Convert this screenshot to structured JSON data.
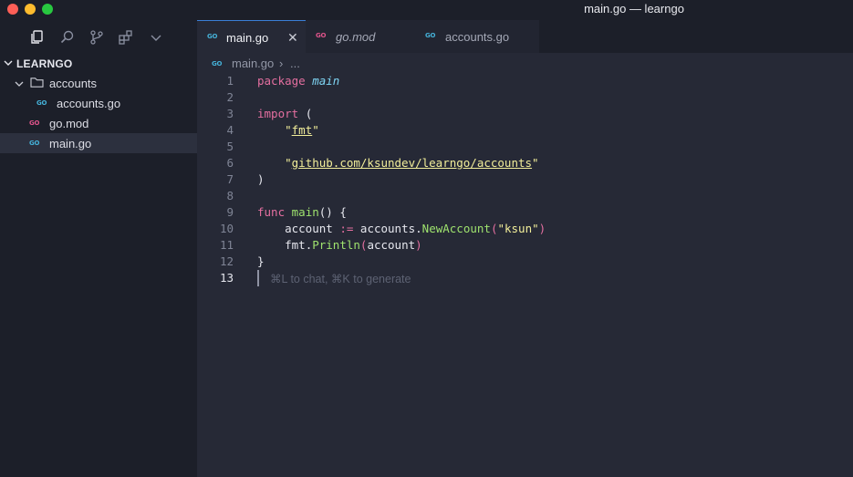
{
  "window": {
    "title": "main.go — learngo"
  },
  "activity_bar": {
    "icons": [
      "files-icon",
      "search-icon",
      "source-control-icon",
      "extensions-icon",
      "chevron-down-icon"
    ]
  },
  "explorer": {
    "root_label": "LEARNGO",
    "items": [
      {
        "label": "accounts",
        "type": "folder",
        "icon": "folder-icon"
      },
      {
        "label": "accounts.go",
        "type": "file",
        "icon": "go-file-icon",
        "badge": "GO"
      },
      {
        "label": "go.mod",
        "type": "file",
        "icon": "go-mod-icon",
        "badge": "GO"
      },
      {
        "label": "main.go",
        "type": "file",
        "icon": "go-file-icon",
        "badge": "GO",
        "selected": true
      }
    ]
  },
  "tabs": [
    {
      "label": "main.go",
      "badge": "GO",
      "active": true,
      "close": "✕"
    },
    {
      "label": "go.mod",
      "badge": "GO",
      "active": false
    },
    {
      "label": "accounts.go",
      "badge": "GO",
      "active": false
    }
  ],
  "breadcrumb": {
    "file": "main.go",
    "separator": "›",
    "more": "..."
  },
  "editor": {
    "line_numbers": [
      "1",
      "2",
      "3",
      "4",
      "5",
      "6",
      "7",
      "8",
      "9",
      "10",
      "11",
      "12",
      "13"
    ],
    "lines": {
      "l1_kw": "package",
      "l1_name": "main",
      "l3_kw": "import",
      "l3_paren": "(",
      "l4_q1": "\"",
      "l4_str": "fmt",
      "l4_q2": "\"",
      "l6_q1": "\"",
      "l6_str": "github.com/ksundev/learngo/accounts",
      "l6_q2": "\"",
      "l7": ")",
      "l9_kw": "func",
      "l9_name": "main",
      "l9_rest": "() {",
      "l10_var": "account",
      "l10_op": ":=",
      "l10_pkg": "accounts",
      "l10_dot": ".",
      "l10_fn": "NewAccount",
      "l10_open": "(",
      "l10_str": "\"ksun\"",
      "l10_close": ")",
      "l11_pkg": "fmt",
      "l11_dot": ".",
      "l11_fn": "Println",
      "l11_open": "(",
      "l11_arg": "account",
      "l11_close": ")",
      "l12": "}"
    },
    "hint": "⌘L to chat, ⌘K to generate"
  }
}
